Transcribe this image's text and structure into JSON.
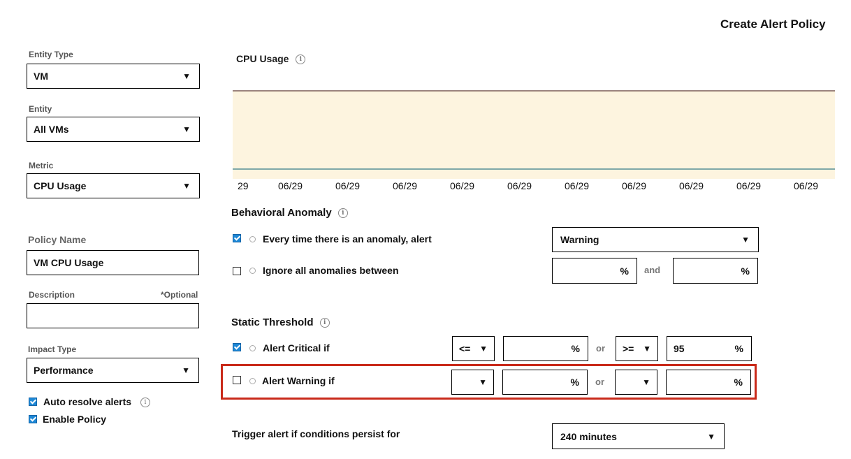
{
  "page": {
    "title": "Create Alert Policy"
  },
  "left": {
    "entity_type": {
      "label": "Entity Type",
      "value": "VM"
    },
    "entity": {
      "label": "Entity",
      "value": "All VMs"
    },
    "metric": {
      "label": "Metric",
      "value": "CPU Usage"
    },
    "policy_name": {
      "label": "Policy Name",
      "value": "VM CPU Usage"
    },
    "description": {
      "label": "Description",
      "optional": "*Optional",
      "value": ""
    },
    "impact_type": {
      "label": "Impact Type",
      "value": "Performance"
    },
    "auto_resolve": {
      "label": "Auto resolve alerts",
      "checked": true
    },
    "enable_policy": {
      "label": "Enable Policy",
      "checked": true
    }
  },
  "chart": {
    "title": "CPU Usage",
    "ticks": [
      "29",
      "06/29",
      "06/29",
      "06/29",
      "06/29",
      "06/29",
      "06/29",
      "06/29",
      "06/29",
      "06/29",
      "06/29"
    ]
  },
  "chart_data": {
    "type": "area",
    "title": "CPU Usage",
    "x": [
      "29",
      "06/29",
      "06/29",
      "06/29",
      "06/29",
      "06/29",
      "06/29",
      "06/29",
      "06/29",
      "06/29",
      "06/29"
    ],
    "band_color": "#fdf4df",
    "upper_line_color": "#7a5a56",
    "lower_line_color": "#7fa8a8"
  },
  "behavioral": {
    "title": "Behavioral Anomaly",
    "every_time": {
      "label": "Every time there is an anomaly, alert",
      "checked": true,
      "severity": "Warning"
    },
    "ignore": {
      "label": "Ignore all anomalies between",
      "checked": false,
      "low": "",
      "high": "",
      "unit": "%",
      "and": "and"
    }
  },
  "static": {
    "title": "Static Threshold",
    "critical": {
      "label": "Alert Critical if",
      "checked": true,
      "op1": "<=",
      "val1": "",
      "or": "or",
      "op2": ">=",
      "val2": "95",
      "unit": "%"
    },
    "warning": {
      "label": "Alert Warning if",
      "checked": false,
      "op1": "",
      "val1": "",
      "or": "or",
      "op2": "",
      "val2": "",
      "unit": "%"
    }
  },
  "trigger": {
    "label": "Trigger alert if conditions persist for",
    "value": "240 minutes"
  },
  "colors": {
    "highlight": "#c92a1a",
    "checkbox": "#1e88d6",
    "chart_band": "#fdf4df"
  },
  "icons": {
    "dropdown": "triangle-down-icon",
    "info": "info-icon"
  }
}
